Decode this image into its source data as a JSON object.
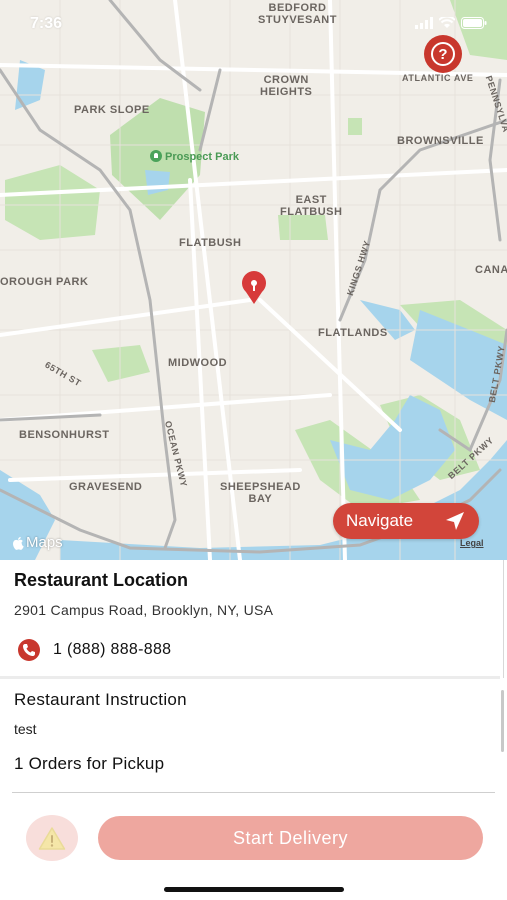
{
  "status_bar": {
    "time": "7:36",
    "icons": [
      "location-arrow-icon",
      "signal-icon",
      "wifi-icon",
      "battery-icon"
    ]
  },
  "map": {
    "labels": {
      "bedford_stuyvesant": "BEDFORD\nSTUYVESANT",
      "crown_heights": "CROWN\nHEIGHTS",
      "atlantic_ave": "ATLANTIC AVE",
      "park_slope": "PARK SLOPE",
      "brownsville": "BROWNSVILLE",
      "prospect_park": "Prospect Park",
      "east_flatbush": "EAST\nFLATBUSH",
      "flatbush": "FLATBUSH",
      "kings_hwy": "KINGS HWY",
      "canarsie": "CANA",
      "borough_park": "OROUGH PARK",
      "flatlands": "FLATLANDS",
      "pennsylvania": "PENNSYLVA",
      "belt_pkwy_right": "BELT PKWY",
      "sixty_fifth_st": "65TH ST",
      "midwood": "MIDWOOD",
      "bensonhurst": "BENSONHURST",
      "ocean_pkwy": "OCEAN PKWY",
      "belt_pkwy": "BELT PKWY",
      "gravesend": "GRAVESEND",
      "sheepshead_bay": "SHEEPSHEAD\nBAY"
    },
    "attribution": "Maps",
    "legal": "Legal",
    "navigate_label": "Navigate"
  },
  "details": {
    "location_title": "Restaurant Location",
    "address": "2901 Campus Road, Brooklyn, NY, USA",
    "phone": "1 (888) 888-888",
    "instruction_title": "Restaurant Instruction",
    "instruction_text": "test",
    "orders_text": "1 Orders for Pickup"
  },
  "actions": {
    "start_delivery_label": "Start Delivery"
  },
  "colors": {
    "accent": "#c8372d",
    "navigate_bg": "#d2453a",
    "start_delivery_disabled": "#eea79f",
    "alert_bg": "#f8dedb",
    "park": "#bfdfae",
    "water": "#a6d4ec"
  }
}
